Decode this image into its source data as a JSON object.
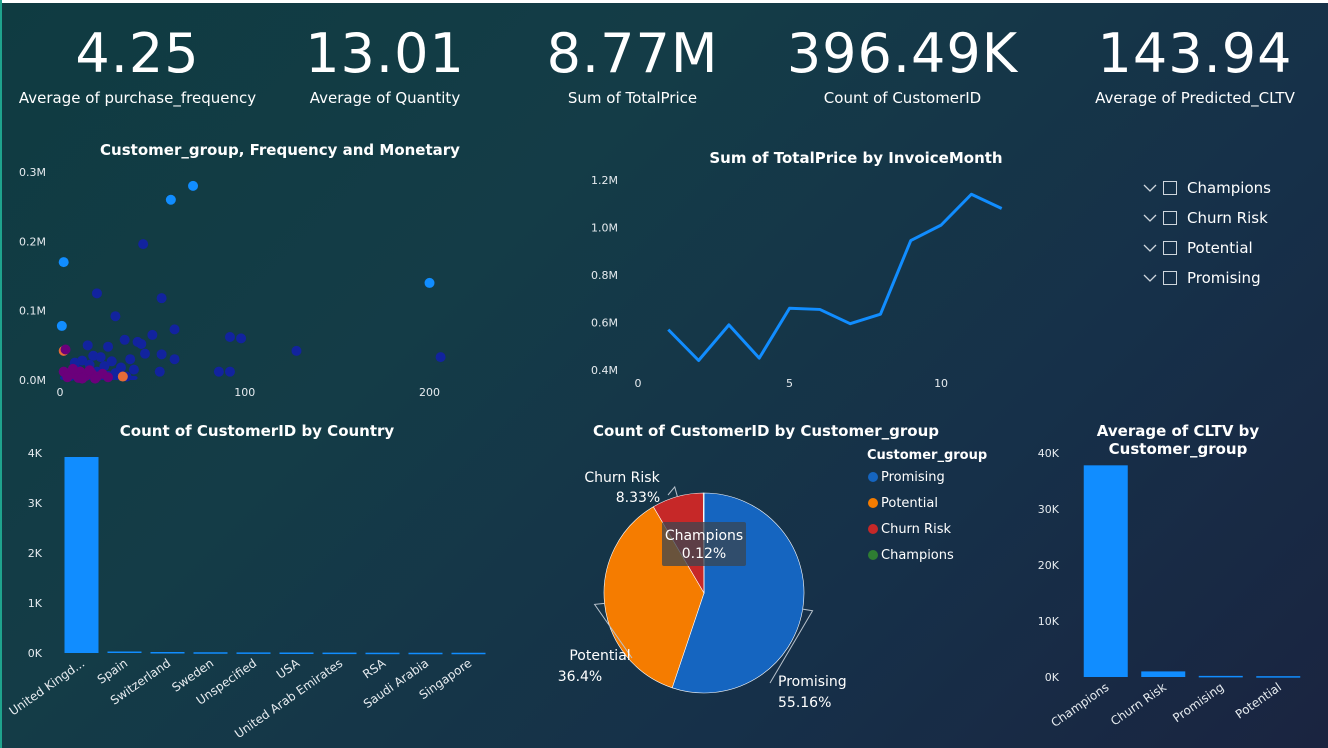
{
  "kpis": [
    {
      "value": "4.25",
      "label": "Average of purchase_frequency"
    },
    {
      "value": "13.01",
      "label": "Average of Quantity"
    },
    {
      "value": "8.77M",
      "label": "Sum of TotalPrice"
    },
    {
      "value": "396.49K",
      "label": "Count of CustomerID"
    },
    {
      "value": "143.94",
      "label": "Average of Predicted_CLTV"
    }
  ],
  "colors": {
    "blue": "#118dff",
    "navy": "#12239e",
    "purple": "#6b007b",
    "orange": "#e66c37",
    "pie_promising": "#1565c0",
    "pie_potential": "#f57c00",
    "pie_churn": "#c62828",
    "pie_champions": "#2e7d32"
  },
  "chart_data": [
    {
      "id": "scatter",
      "type": "scatter",
      "title": "Customer_group, Frequency and Monetary",
      "xlabel": "",
      "ylabel": "",
      "xlim": [
        0,
        210
      ],
      "ylim": [
        0,
        300000
      ],
      "x_ticks": [
        "0",
        "100",
        "200"
      ],
      "x_tick_values": [
        0,
        100,
        200
      ],
      "y_ticks": [
        "0.0M",
        "0.1M",
        "0.2M",
        "0.3M"
      ],
      "y_tick_values": [
        0,
        100000,
        200000,
        300000
      ],
      "points": [
        {
          "x": 72,
          "y": 280000,
          "c": "blue"
        },
        {
          "x": 60,
          "y": 260000,
          "c": "blue"
        },
        {
          "x": 2,
          "y": 170000,
          "c": "blue"
        },
        {
          "x": 200,
          "y": 140000,
          "c": "blue"
        },
        {
          "x": 1,
          "y": 78000,
          "c": "blue"
        },
        {
          "x": 45,
          "y": 196000,
          "c": "navy"
        },
        {
          "x": 20,
          "y": 125000,
          "c": "navy"
        },
        {
          "x": 55,
          "y": 118000,
          "c": "navy"
        },
        {
          "x": 30,
          "y": 92000,
          "c": "navy"
        },
        {
          "x": 62,
          "y": 73000,
          "c": "navy"
        },
        {
          "x": 50,
          "y": 65000,
          "c": "navy"
        },
        {
          "x": 92,
          "y": 62000,
          "c": "navy"
        },
        {
          "x": 98,
          "y": 60000,
          "c": "navy"
        },
        {
          "x": 35,
          "y": 58000,
          "c": "navy"
        },
        {
          "x": 42,
          "y": 55000,
          "c": "navy"
        },
        {
          "x": 44,
          "y": 52000,
          "c": "navy"
        },
        {
          "x": 15,
          "y": 50000,
          "c": "navy"
        },
        {
          "x": 26,
          "y": 48000,
          "c": "navy"
        },
        {
          "x": 128,
          "y": 42000,
          "c": "navy"
        },
        {
          "x": 46,
          "y": 38000,
          "c": "navy"
        },
        {
          "x": 55,
          "y": 37000,
          "c": "navy"
        },
        {
          "x": 18,
          "y": 35000,
          "c": "navy"
        },
        {
          "x": 22,
          "y": 33000,
          "c": "navy"
        },
        {
          "x": 62,
          "y": 30000,
          "c": "navy"
        },
        {
          "x": 206,
          "y": 33000,
          "c": "navy"
        },
        {
          "x": 38,
          "y": 30000,
          "c": "navy"
        },
        {
          "x": 12,
          "y": 28000,
          "c": "navy"
        },
        {
          "x": 28,
          "y": 27000,
          "c": "navy"
        },
        {
          "x": 8,
          "y": 25000,
          "c": "navy"
        },
        {
          "x": 16,
          "y": 22000,
          "c": "navy"
        },
        {
          "x": 24,
          "y": 20000,
          "c": "navy"
        },
        {
          "x": 33,
          "y": 18000,
          "c": "navy"
        },
        {
          "x": 40,
          "y": 15000,
          "c": "navy"
        },
        {
          "x": 54,
          "y": 12000,
          "c": "navy"
        },
        {
          "x": 86,
          "y": 12000,
          "c": "navy"
        },
        {
          "x": 92,
          "y": 12000,
          "c": "navy"
        },
        {
          "x": 10,
          "y": 14000,
          "c": "navy"
        },
        {
          "x": 20,
          "y": 12000,
          "c": "navy"
        },
        {
          "x": 30,
          "y": 10000,
          "c": "navy"
        },
        {
          "x": 14,
          "y": 8000,
          "c": "navy"
        },
        {
          "x": 6,
          "y": 6000,
          "c": "navy"
        },
        {
          "x": 26,
          "y": 6000,
          "c": "navy"
        },
        {
          "x": 36,
          "y": 5000,
          "c": "navy"
        },
        {
          "x": 2,
          "y": 42000,
          "c": "orange"
        },
        {
          "x": 34,
          "y": 5000,
          "c": "orange"
        },
        {
          "x": 3,
          "y": 44000,
          "c": "purple"
        },
        {
          "x": 2,
          "y": 12000,
          "c": "purple"
        },
        {
          "x": 5,
          "y": 10000,
          "c": "purple"
        },
        {
          "x": 8,
          "y": 8000,
          "c": "purple"
        },
        {
          "x": 11,
          "y": 12000,
          "c": "purple"
        },
        {
          "x": 14,
          "y": 6000,
          "c": "purple"
        },
        {
          "x": 17,
          "y": 10000,
          "c": "purple"
        },
        {
          "x": 20,
          "y": 5000,
          "c": "purple"
        },
        {
          "x": 23,
          "y": 9000,
          "c": "purple"
        },
        {
          "x": 26,
          "y": 4000,
          "c": "purple"
        },
        {
          "x": 4,
          "y": 4000,
          "c": "purple"
        },
        {
          "x": 10,
          "y": 3000,
          "c": "purple"
        },
        {
          "x": 16,
          "y": 14000,
          "c": "purple"
        },
        {
          "x": 7,
          "y": 16000,
          "c": "purple"
        },
        {
          "x": 12,
          "y": 2000,
          "c": "purple"
        },
        {
          "x": 19,
          "y": 2000,
          "c": "purple"
        }
      ]
    },
    {
      "id": "line",
      "type": "line",
      "title": "Sum of TotalPrice by InvoiceMonth",
      "xlabel": "",
      "ylabel": "",
      "xlim": [
        0,
        13
      ],
      "ylim": [
        400000,
        1200000
      ],
      "x_ticks": [
        "0",
        "5",
        "10"
      ],
      "x_tick_values": [
        0,
        5,
        10
      ],
      "y_ticks": [
        "0.4M",
        "0.6M",
        "0.8M",
        "1.0M",
        "1.2M"
      ],
      "y_tick_values": [
        400000,
        600000,
        800000,
        1000000,
        1200000
      ],
      "x": [
        1,
        2,
        3,
        4,
        5,
        6,
        7,
        8,
        9,
        10,
        11,
        12
      ],
      "y": [
        570000,
        440000,
        590000,
        450000,
        660000,
        655000,
        595000,
        635000,
        945000,
        1010000,
        1140000,
        1080000
      ],
      "legend": [
        "Champions",
        "Churn Risk",
        "Potential",
        "Promising"
      ]
    },
    {
      "id": "country",
      "type": "bar",
      "title": "Count of CustomerID by Country",
      "xlabel": "",
      "ylabel": "",
      "ylim": [
        0,
        4000
      ],
      "y_ticks": [
        "0K",
        "1K",
        "2K",
        "3K",
        "4K"
      ],
      "y_tick_values": [
        0,
        1000,
        2000,
        3000,
        4000
      ],
      "categories": [
        "United Kingd...",
        "Spain",
        "Switzerland",
        "Sweden",
        "Unspecified",
        "USA",
        "United Arab Emirates",
        "RSA",
        "Saudi Arabia",
        "Singapore"
      ],
      "values": [
        3920,
        30,
        20,
        15,
        12,
        10,
        8,
        6,
        5,
        5
      ]
    },
    {
      "id": "pie",
      "type": "pie",
      "title": "Count of CustomerID by Customer_group",
      "legend_title": "Customer_group",
      "slices": [
        {
          "label": "Promising",
          "value": 55.16,
          "pct": "55.16%",
          "c": "pie_promising"
        },
        {
          "label": "Potential",
          "value": 36.4,
          "pct": "36.4%",
          "c": "pie_potential"
        },
        {
          "label": "Churn Risk",
          "value": 8.33,
          "pct": "8.33%",
          "c": "pie_churn"
        },
        {
          "label": "Champions",
          "value": 0.12,
          "pct": "0.12%",
          "c": "pie_champions"
        }
      ]
    },
    {
      "id": "cltv",
      "type": "bar",
      "title": "Average of CLTV by Customer_group",
      "xlabel": "",
      "ylabel": "",
      "ylim": [
        0,
        40000
      ],
      "y_ticks": [
        "0K",
        "10K",
        "20K",
        "30K",
        "40K"
      ],
      "y_tick_values": [
        0,
        10000,
        20000,
        30000,
        40000
      ],
      "categories": [
        "Champions",
        "Churn Risk",
        "Promising",
        "Potential"
      ],
      "values": [
        37800,
        1000,
        200,
        150
      ]
    }
  ]
}
